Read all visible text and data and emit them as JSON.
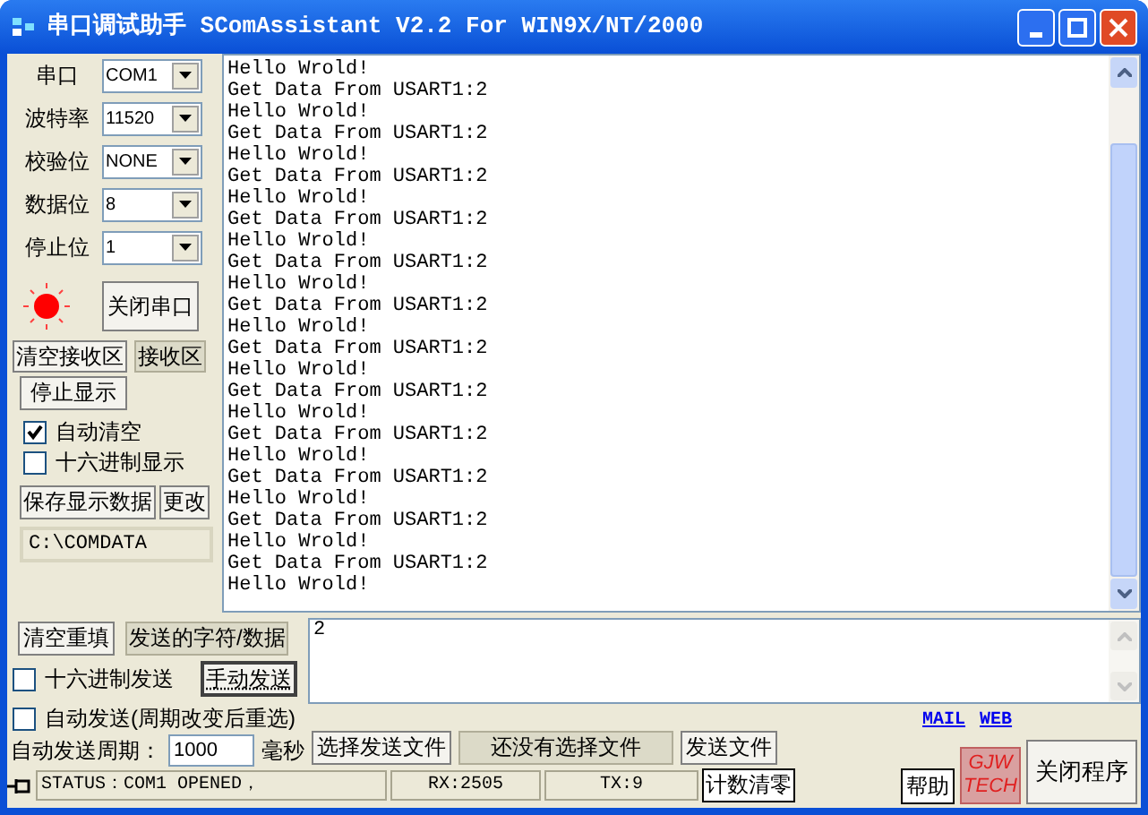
{
  "window": {
    "title": "串口调试助手  SComAssistant V2.2 For WIN9X/NT/2000"
  },
  "settings": [
    {
      "label": "串口",
      "value": "COM1"
    },
    {
      "label": "波特率",
      "value": "11520"
    },
    {
      "label": "校验位",
      "value": "NONE"
    },
    {
      "label": "数据位",
      "value": "8"
    },
    {
      "label": "停止位",
      "value": "1"
    }
  ],
  "port": {
    "led_on": true,
    "button": "关闭串口"
  },
  "receive": {
    "clear_button": "清空接收区",
    "area_label": "接收区",
    "stop_button": "停止显示",
    "options": [
      {
        "label": "自动清空",
        "checked": true
      },
      {
        "label": "十六进制显示",
        "checked": false
      }
    ],
    "save_button": "保存显示数据",
    "change_button": "更改",
    "path": "C:\\COMDATA",
    "lines": [
      "Hello Wrold!",
      "Get Data From USART1:2",
      "Hello Wrold!",
      "Get Data From USART1:2",
      "Hello Wrold!",
      "Get Data From USART1:2",
      "Hello Wrold!",
      "Get Data From USART1:2",
      "Hello Wrold!",
      "Get Data From USART1:2",
      "Hello Wrold!",
      "Get Data From USART1:2",
      "Hello Wrold!",
      "Get Data From USART1:2",
      "Hello Wrold!",
      "Get Data From USART1:2",
      "Hello Wrold!",
      "Get Data From USART1:2",
      "Hello Wrold!",
      "Get Data From USART1:2",
      "Hello Wrold!",
      "Get Data From USART1:2",
      "Hello Wrold!",
      "Get Data From USART1:2",
      "Hello Wrold!"
    ]
  },
  "send": {
    "clear_button": "清空重填",
    "area_label": "发送的字符/数据",
    "text": "2",
    "hex_option": {
      "label": "十六进制发送",
      "checked": false
    },
    "manual_button": "手动发送",
    "auto_option": {
      "label": "自动发送(周期改变后重选)",
      "checked": false
    },
    "period_label": "自动发送周期：",
    "period_value": "1000",
    "period_unit": "毫秒",
    "choose_file_button": "选择发送文件",
    "file_label": "还没有选择文件",
    "send_file_button": "发送文件"
  },
  "links": [
    "MAIL",
    "WEB"
  ],
  "help_button": "帮助",
  "logo": [
    "GJW",
    "TECH"
  ],
  "close_button": "关闭程序",
  "status_bar": {
    "status": "STATUS：COM1 OPENED，",
    "rx": "RX:2505",
    "tx": "TX:9",
    "reset_button": "计数清零"
  }
}
